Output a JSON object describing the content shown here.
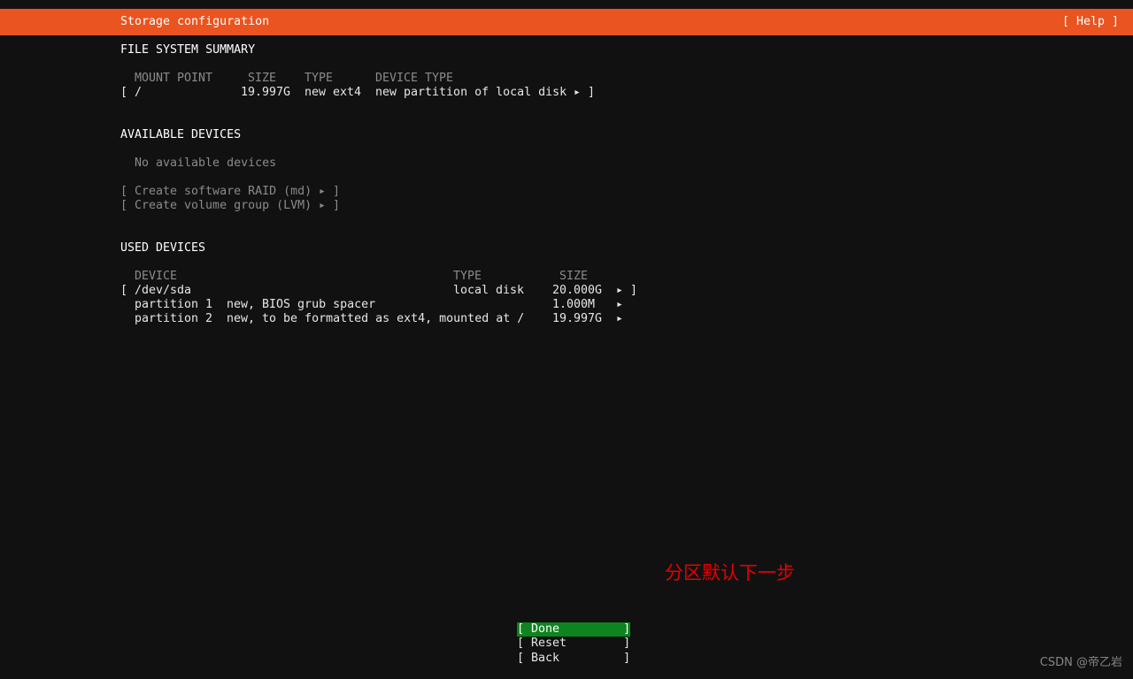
{
  "header": {
    "title": "Storage configuration",
    "help_label": "[ Help ]",
    "background_color": "#e95420",
    "text_color": "#ffffff"
  },
  "filesystem_summary": {
    "section_title": "FILE SYSTEM SUMMARY",
    "columns": {
      "mount_point": "MOUNT POINT",
      "size": "SIZE",
      "type": "TYPE",
      "device_type": "DEVICE TYPE"
    },
    "rows": [
      {
        "bracket_open": "[",
        "mount_point": "/",
        "size": "19.997G",
        "type": "new ext4",
        "device_type": "new partition of local disk",
        "arrow": "▸",
        "bracket_close": "]"
      }
    ]
  },
  "available_devices": {
    "section_title": "AVAILABLE DEVICES",
    "empty_message": "No available devices",
    "actions": [
      {
        "bracket_open": "[",
        "label": "Create software RAID (md)",
        "arrow": "▸",
        "bracket_close": "]"
      },
      {
        "bracket_open": "[",
        "label": "Create volume group (LVM)",
        "arrow": "▸",
        "bracket_close": "]"
      }
    ]
  },
  "used_devices": {
    "section_title": "USED DEVICES",
    "columns": {
      "device": "DEVICE",
      "type": "TYPE",
      "size": "SIZE"
    },
    "rows": [
      {
        "bracket_open": "[",
        "device": "/dev/sda",
        "detail": "",
        "type": "local disk",
        "size": "20.000G",
        "arrow": "▸",
        "bracket_close": "]"
      },
      {
        "bracket_open": "",
        "device": "partition 1",
        "detail": "new, BIOS grub spacer",
        "type": "",
        "size": "1.000M",
        "arrow": "▸",
        "bracket_close": ""
      },
      {
        "bracket_open": "",
        "device": "partition 2",
        "detail": "new, to be formatted as ext4, mounted at /",
        "type": "",
        "size": "19.997G",
        "arrow": "▸",
        "bracket_close": ""
      }
    ]
  },
  "footer_buttons": [
    {
      "label": "[ Done         ]",
      "selected": true,
      "highlight_color": "#0e8420"
    },
    {
      "label": "[ Reset        ]",
      "selected": false,
      "highlight_color": ""
    },
    {
      "label": "[ Back         ]",
      "selected": false,
      "highlight_color": ""
    }
  ],
  "annotation": {
    "text": "分区默认下一步",
    "color": "#e60000"
  },
  "watermark": {
    "text": "CSDN @帝乙岩"
  }
}
